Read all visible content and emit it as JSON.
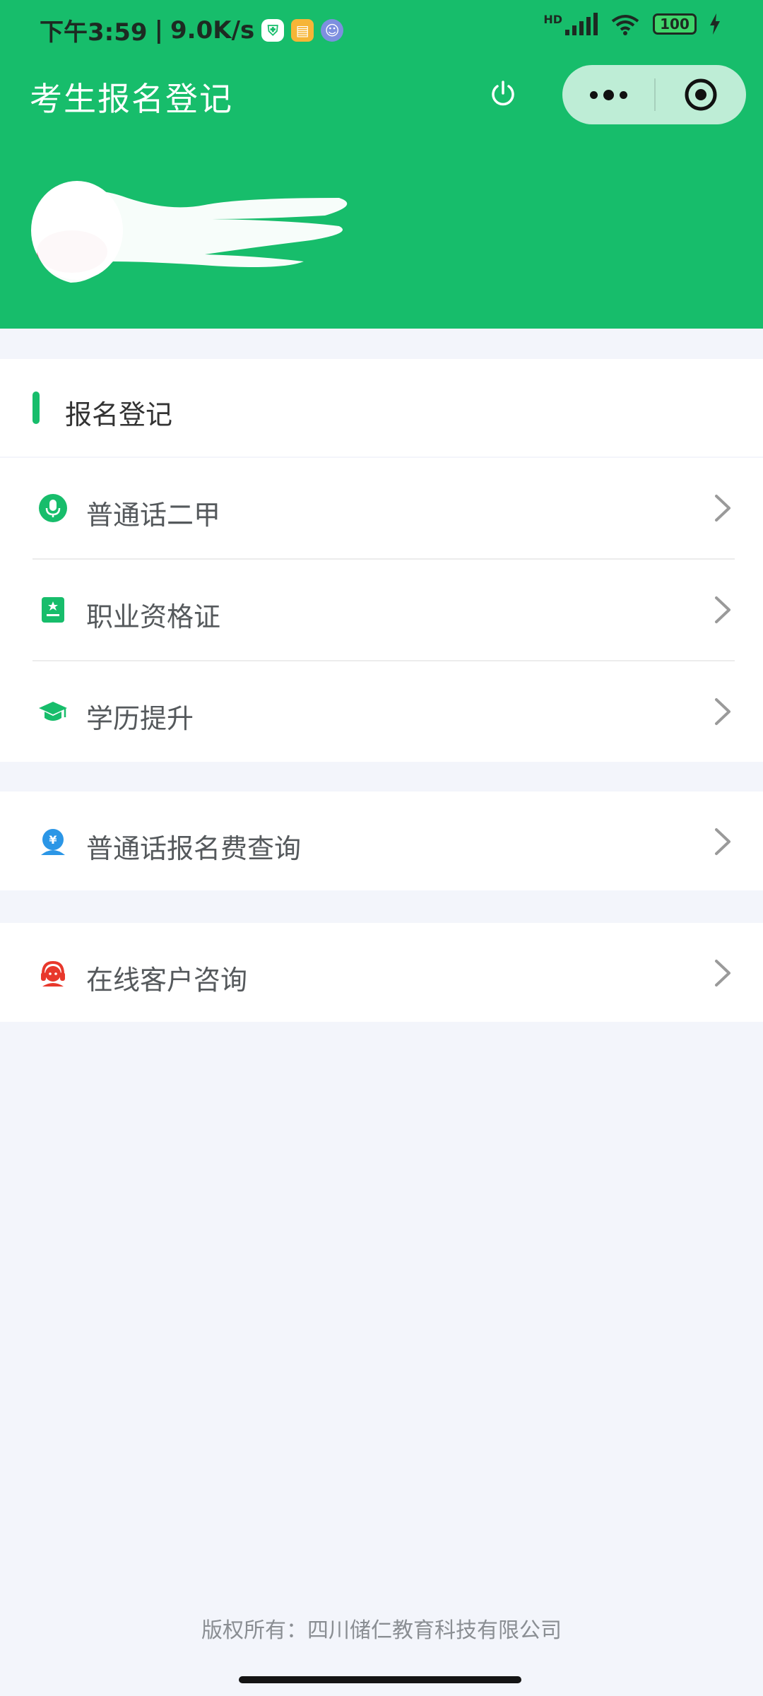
{
  "statusbar": {
    "time": "下午3:59",
    "network_speed": "9.0K/s",
    "hd_label": "HD",
    "battery": "100"
  },
  "nav": {
    "title": "考生报名登记"
  },
  "section": {
    "title": "报名登记"
  },
  "menu": {
    "items": [
      {
        "label": "普通话二甲",
        "icon": "microphone-icon"
      },
      {
        "label": "职业资格证",
        "icon": "certificate-icon"
      },
      {
        "label": "学历提升",
        "icon": "graduation-cap-icon"
      }
    ]
  },
  "fee_query": {
    "label": "普通话报名费查询",
    "icon": "yuan-user-icon"
  },
  "customer_service": {
    "label": "在线客户咨询",
    "icon": "headset-icon"
  },
  "footer": {
    "copyright": "版权所有：四川储仁教育科技有限公司"
  },
  "colors": {
    "brand": "#17bd6b",
    "background": "#f3f5fb",
    "icon_red": "#e8382c",
    "icon_blue": "#2b96e6"
  }
}
